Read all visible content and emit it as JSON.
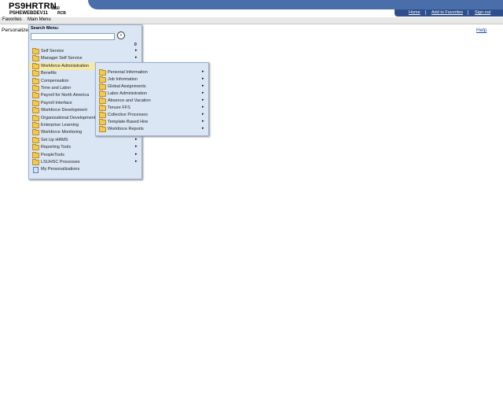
{
  "header": {
    "env_title": "PS9HRTRN",
    "env_version": "8.50",
    "server_name": "PSHEWEBDEV11",
    "server_user": "RCB",
    "links": [
      {
        "label": "Home"
      },
      {
        "label": "Add to Favorites"
      },
      {
        "label": "Sign out"
      }
    ]
  },
  "menubar": {
    "favorites": "Favorites",
    "main_menu": "Main Menu"
  },
  "page": {
    "personalize": "Personalize",
    "help": "Help"
  },
  "main_menu": {
    "search_label": "Search Menu:",
    "search_value": "",
    "search_go_glyph": "»",
    "scroll_indicator": "0",
    "items": [
      {
        "label": "Self Service",
        "icon": "folder-icon",
        "submenu": true
      },
      {
        "label": "Manager Self Service",
        "icon": "folder-icon",
        "submenu": true
      },
      {
        "label": "Workforce Administration",
        "icon": "folder-icon",
        "submenu": true,
        "highlighted": true
      },
      {
        "label": "Benefits",
        "icon": "folder-icon",
        "submenu": false
      },
      {
        "label": "Compensation",
        "icon": "folder-icon",
        "submenu": false
      },
      {
        "label": "Time and Labor",
        "icon": "folder-icon",
        "submenu": false
      },
      {
        "label": "Payroll for North America",
        "icon": "folder-icon",
        "submenu": false
      },
      {
        "label": "Payroll Interface",
        "icon": "folder-icon",
        "submenu": false
      },
      {
        "label": "Workforce Development",
        "icon": "folder-icon",
        "submenu": false
      },
      {
        "label": "Organizational Development",
        "icon": "folder-icon",
        "submenu": false
      },
      {
        "label": "Enterprise Learning",
        "icon": "folder-icon",
        "submenu": false
      },
      {
        "label": "Workforce Monitoring",
        "icon": "folder-icon",
        "submenu": false
      },
      {
        "label": "Set Up HRMS",
        "icon": "folder-icon",
        "submenu": true
      },
      {
        "label": "Reporting Tools",
        "icon": "folder-icon",
        "submenu": true
      },
      {
        "label": "PeopleTools",
        "icon": "folder-icon",
        "submenu": true
      },
      {
        "label": "LSUHSC Processes",
        "icon": "folder-icon",
        "submenu": true
      },
      {
        "label": "My Personalizations",
        "icon": "document-icon",
        "submenu": false
      }
    ]
  },
  "submenu": {
    "items": [
      {
        "label": "Personal Information"
      },
      {
        "label": "Job Information"
      },
      {
        "label": "Global Assignments"
      },
      {
        "label": "Labor Administration"
      },
      {
        "label": "Absence and Vacation"
      },
      {
        "label": "Tenure FFS"
      },
      {
        "label": "Collective Processes"
      },
      {
        "label": "Template-Based Hire"
      },
      {
        "label": "Workforce Reports"
      }
    ]
  },
  "colors": {
    "banner": "#4a6ea9",
    "banner_links": "#2e4f8c",
    "menu_bg": "#dbe6f4",
    "highlight": "#f6e9a6"
  }
}
